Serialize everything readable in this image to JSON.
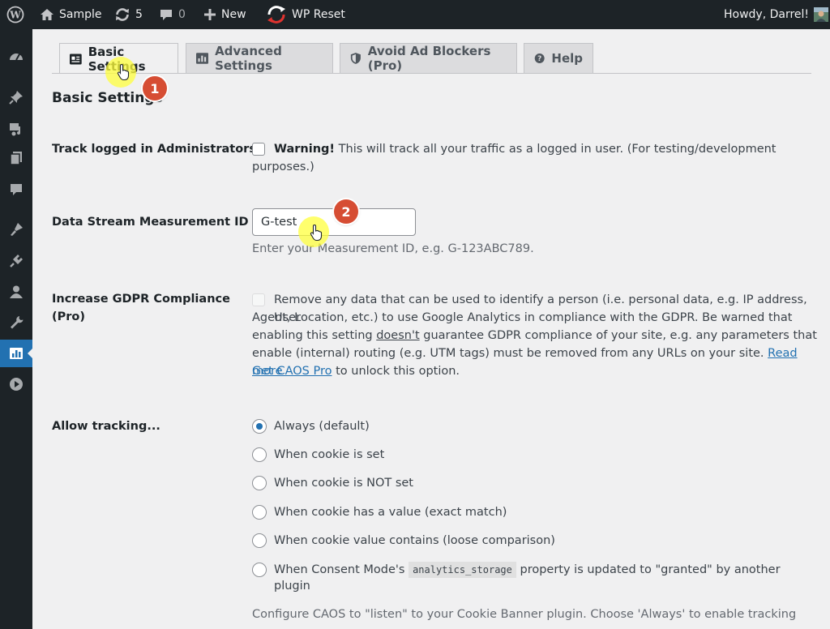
{
  "admin_bar": {
    "site_name": "Sample",
    "updates_count": "5",
    "comments_count": "0",
    "new_label": "New",
    "plugin_label": "WP Reset",
    "greeting": "Howdy, Darrel!"
  },
  "colors": {
    "admin_bar_bg": "#1d2327",
    "accent": "#2271b1",
    "annotation_badge": "#d64d33",
    "cursor_highlight": "#ffff3c"
  },
  "sidebar": {
    "icons": [
      "dashboard-icon",
      "pin-icon",
      "media-icon",
      "pages-icon",
      "comments-icon",
      "appearance-icon",
      "plugins-icon",
      "users-icon",
      "tools-icon",
      "caos-icon",
      "play-icon"
    ],
    "active_icon": "caos-icon"
  },
  "tabs": [
    {
      "label": "Basic Settings",
      "icon": "id-card-icon",
      "active": true
    },
    {
      "label": "Advanced Settings",
      "icon": "analytics-icon",
      "active": false
    },
    {
      "label": "Avoid Ad Blockers (Pro)",
      "icon": "shield-icon",
      "active": false
    },
    {
      "label": "Help",
      "icon": "help-icon",
      "active": false
    }
  ],
  "page_title": "Basic Settings",
  "settings": {
    "track_admins": {
      "label": "Track logged in Administrators",
      "warning": "Warning!",
      "text_line1": " This will track all your traffic as a logged in user. (For testing/development",
      "text_line2": "purposes.)"
    },
    "measurement_id": {
      "label": "Data Stream Measurement ID",
      "value": "G-test",
      "description": "Enter your Measurement ID, e.g. G-123ABC789."
    },
    "gdpr": {
      "label_line1": "Increase GDPR Compliance",
      "label_line2": "(Pro)",
      "line1": "Remove any data that can be used to identify a person (i.e. personal data, e.g. IP address, User",
      "line2": "Agent, Location, etc.) to use Google Analytics in compliance with the GDPR. Be warned that",
      "line3_pre": "enabling this setting ",
      "line3_u": "doesn't",
      "line3_post": " guarantee GDPR compliance of your site, e.g. any parameters that",
      "line4_pre": "enable (internal) routing (e.g. UTM tags) must be removed from any URLs on your site. ",
      "line4_link": "Read more",
      "line5_link": "Get CAOS Pro",
      "line5_post": " to unlock this option."
    },
    "allow_tracking": {
      "label": "Allow tracking...",
      "options": [
        "Always (default)",
        "When cookie is set",
        "When cookie is NOT set",
        "When cookie has a value (exact match)",
        "When cookie value contains (loose comparison)"
      ],
      "consent_pre": "When Consent Mode's",
      "consent_code": "analytics_storage",
      "consent_post": "property is updated to \"granted\" by another",
      "consent_line2": "plugin",
      "selected_index": 0,
      "footer_text": "Configure CAOS to \"listen\" to your Cookie Banner plugin. Choose 'Always' to enable tracking"
    }
  },
  "annotations": [
    "1",
    "2"
  ]
}
